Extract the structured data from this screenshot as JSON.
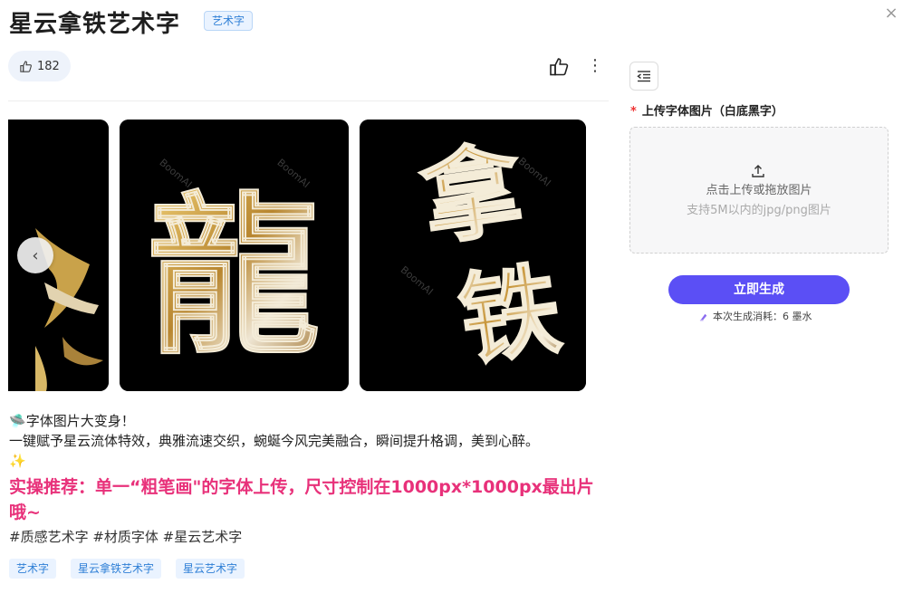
{
  "header": {
    "title": "星云拿铁艺术字",
    "category_tag": "艺术字",
    "close_symbol": "×"
  },
  "stats": {
    "likes": "182"
  },
  "carousel": {
    "prev_symbol": "‹",
    "watermark": "BoomAI",
    "images": [
      {
        "chars": "",
        "description": "partially visible artwork"
      },
      {
        "chars": "龍",
        "description": "golden marbled calligraphy 龍"
      },
      {
        "chars": "拿铁",
        "description": "golden marbled calligraphy 拿铁"
      }
    ]
  },
  "description": {
    "line1_emoji": "🛸",
    "line1": "字体图片大变身！",
    "line2": "一键赋予星云流体特效，典雅流速交织，蜿蜒今风完美融合，瞬间提升格调，美到心醉。",
    "line3_emoji": "✨",
    "highlight": "实操推荐：单一“粗笔画\"的字体上传，尺寸控制在1000px*1000px最出片哦~",
    "hashtags": "#质感艺术字 #材质字体 #星云艺术字"
  },
  "tags": [
    "艺术字",
    "星云拿铁艺术字",
    "星云艺术字"
  ],
  "panel": {
    "upload_label": "上传字体图片（白底黑字）",
    "required_mark": "*",
    "upload_main": "点击上传或拖放图片",
    "upload_sub": "支持5M以内的jpg/png图片",
    "generate_button": "立即生成",
    "cost_text": "本次生成消耗：6 墨水"
  },
  "colors": {
    "accent": "#5b4ff5",
    "highlight": "#e8317a",
    "tag_text": "#2e7fd6",
    "tag_bg": "#eaf3ff"
  }
}
